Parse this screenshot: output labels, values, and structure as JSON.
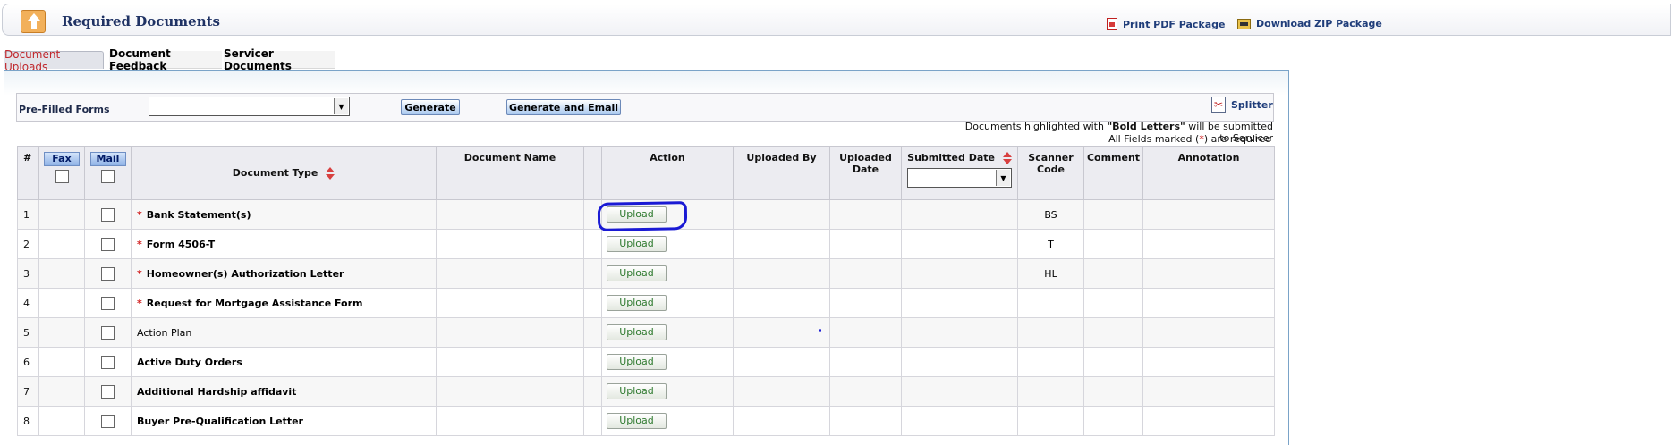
{
  "header": {
    "title": "Required Documents",
    "print_pdf": "Print PDF Package",
    "download_zip": "Download ZIP Package"
  },
  "tabs": [
    {
      "label": "Document Uploads",
      "active": true
    },
    {
      "label": "Document Feedback",
      "active": false
    },
    {
      "label": "Servicer Documents",
      "active": false
    }
  ],
  "prefilled": {
    "label": "Pre-Filled Forms",
    "selected": "",
    "generate": "Generate",
    "generate_email": "Generate and Email",
    "splitter": "Splitter"
  },
  "notes": {
    "bold_prefix": "Documents highlighted with ",
    "bold_term": "\"Bold Letters\"",
    "bold_suffix": " will be submitted to Servicer",
    "req_prefix": "All Fields marked (",
    "req_star": "*",
    "req_suffix": ") are required"
  },
  "table": {
    "headers": {
      "num": "#",
      "fax": "Fax",
      "mail": "Mail",
      "doc_type": "Document Type",
      "doc_name": "Document Name",
      "action": "Action",
      "uploaded_by": "Uploaded By",
      "uploaded_date": "Uploaded Date",
      "submitted_date": "Submitted Date",
      "scanner_code": "Scanner Code",
      "comment": "Comment",
      "annotation": "Annotation"
    },
    "submitted_date_filter": "",
    "upload_label": "Upload",
    "rows": [
      {
        "num": "1",
        "doc_type": "Bank Statement(s)",
        "required": true,
        "bold": true,
        "code": "BS"
      },
      {
        "num": "2",
        "doc_type": "Form 4506-T",
        "required": true,
        "bold": true,
        "code": "T"
      },
      {
        "num": "3",
        "doc_type": "Homeowner(s) Authorization Letter",
        "required": true,
        "bold": true,
        "code": "HL"
      },
      {
        "num": "4",
        "doc_type": "Request for Mortgage Assistance Form",
        "required": true,
        "bold": true,
        "code": ""
      },
      {
        "num": "5",
        "doc_type": "Action Plan",
        "required": false,
        "bold": false,
        "code": ""
      },
      {
        "num": "6",
        "doc_type": "Active Duty Orders",
        "required": false,
        "bold": true,
        "code": ""
      },
      {
        "num": "7",
        "doc_type": "Additional Hardship affidavit",
        "required": false,
        "bold": true,
        "code": ""
      },
      {
        "num": "8",
        "doc_type": "Buyer Pre-Qualification Letter",
        "required": false,
        "bold": true,
        "code": ""
      }
    ]
  },
  "colors": {
    "title": "#1f3264",
    "active_tab": "#c0282d",
    "required_star": "#d01818",
    "upload_text": "#2f7a2f",
    "annotation_ring": "#1a1ad4"
  },
  "icons": [
    "home-up-icon",
    "pdf-icon",
    "zip-icon",
    "scissors-icon",
    "sort-icon",
    "dropdown-arrow-icon"
  ]
}
